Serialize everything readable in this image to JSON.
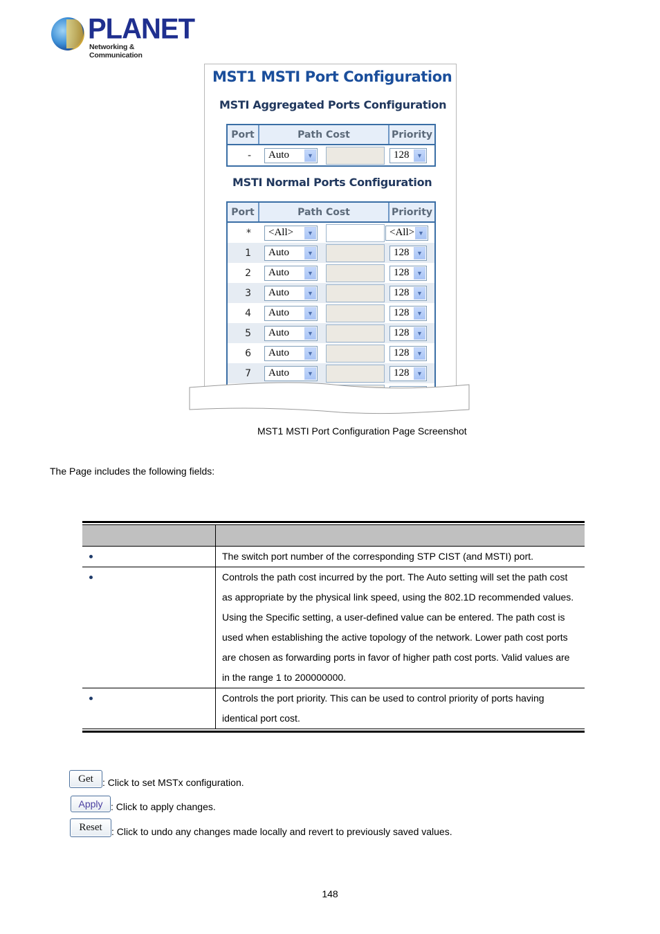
{
  "logo": {
    "brand": "PLANET",
    "tagline": "Networking & Communication"
  },
  "screenshot": {
    "title": "MST1 MSTI Port Configuration",
    "aggregated": {
      "heading": "MSTI Aggregated Ports Configuration",
      "columns": [
        "Port",
        "Path Cost",
        "Priority"
      ],
      "rows": [
        {
          "port": "-",
          "path_cost_mode": "Auto",
          "path_cost_value": "",
          "priority": "128"
        }
      ]
    },
    "normal": {
      "heading": "MSTI Normal Ports Configuration",
      "columns": [
        "Port",
        "Path Cost",
        "Priority"
      ],
      "rows": [
        {
          "port": "*",
          "path_cost_mode": "<All>",
          "path_cost_value": "",
          "priority": "<All>"
        },
        {
          "port": "1",
          "path_cost_mode": "Auto",
          "path_cost_value": "",
          "priority": "128"
        },
        {
          "port": "2",
          "path_cost_mode": "Auto",
          "path_cost_value": "",
          "priority": "128"
        },
        {
          "port": "3",
          "path_cost_mode": "Auto",
          "path_cost_value": "",
          "priority": "128"
        },
        {
          "port": "4",
          "path_cost_mode": "Auto",
          "path_cost_value": "",
          "priority": "128"
        },
        {
          "port": "5",
          "path_cost_mode": "Auto",
          "path_cost_value": "",
          "priority": "128"
        },
        {
          "port": "6",
          "path_cost_mode": "Auto",
          "path_cost_value": "",
          "priority": "128"
        },
        {
          "port": "7",
          "path_cost_mode": "Auto",
          "path_cost_value": "",
          "priority": "128"
        }
      ]
    },
    "dropdown_icon": "chevron-down-icon"
  },
  "caption": "MST1 MSTI Port Configuration Page Screenshot",
  "intro": "The Page includes the following fields:",
  "fields_table": {
    "headers": [
      "",
      ""
    ],
    "rows": [
      {
        "object": "",
        "description": "The switch port number of the corresponding STP CIST (and MSTI) port."
      },
      {
        "object": "",
        "description": "Controls the path cost incurred by the port. The Auto setting will set the path cost as appropriate by the physical link speed, using the 802.1D recommended values. Using the Specific setting, a user-defined value can be entered. The path cost is used when establishing the active topology of the network. Lower path cost ports are chosen as forwarding ports in favor of higher path cost ports. Valid values are in the range 1 to 200000000."
      },
      {
        "object": "",
        "description": "Controls the port priority. This can be used to control priority of ports having identical port cost."
      }
    ]
  },
  "buttons": [
    {
      "label": "Get",
      "description": ": Click to set MSTx configuration."
    },
    {
      "label": "Apply",
      "description": ": Click to apply changes."
    },
    {
      "label": "Reset",
      "description": ": Click to undo any changes made locally and revert to previously saved values."
    }
  ],
  "page_number": "148"
}
